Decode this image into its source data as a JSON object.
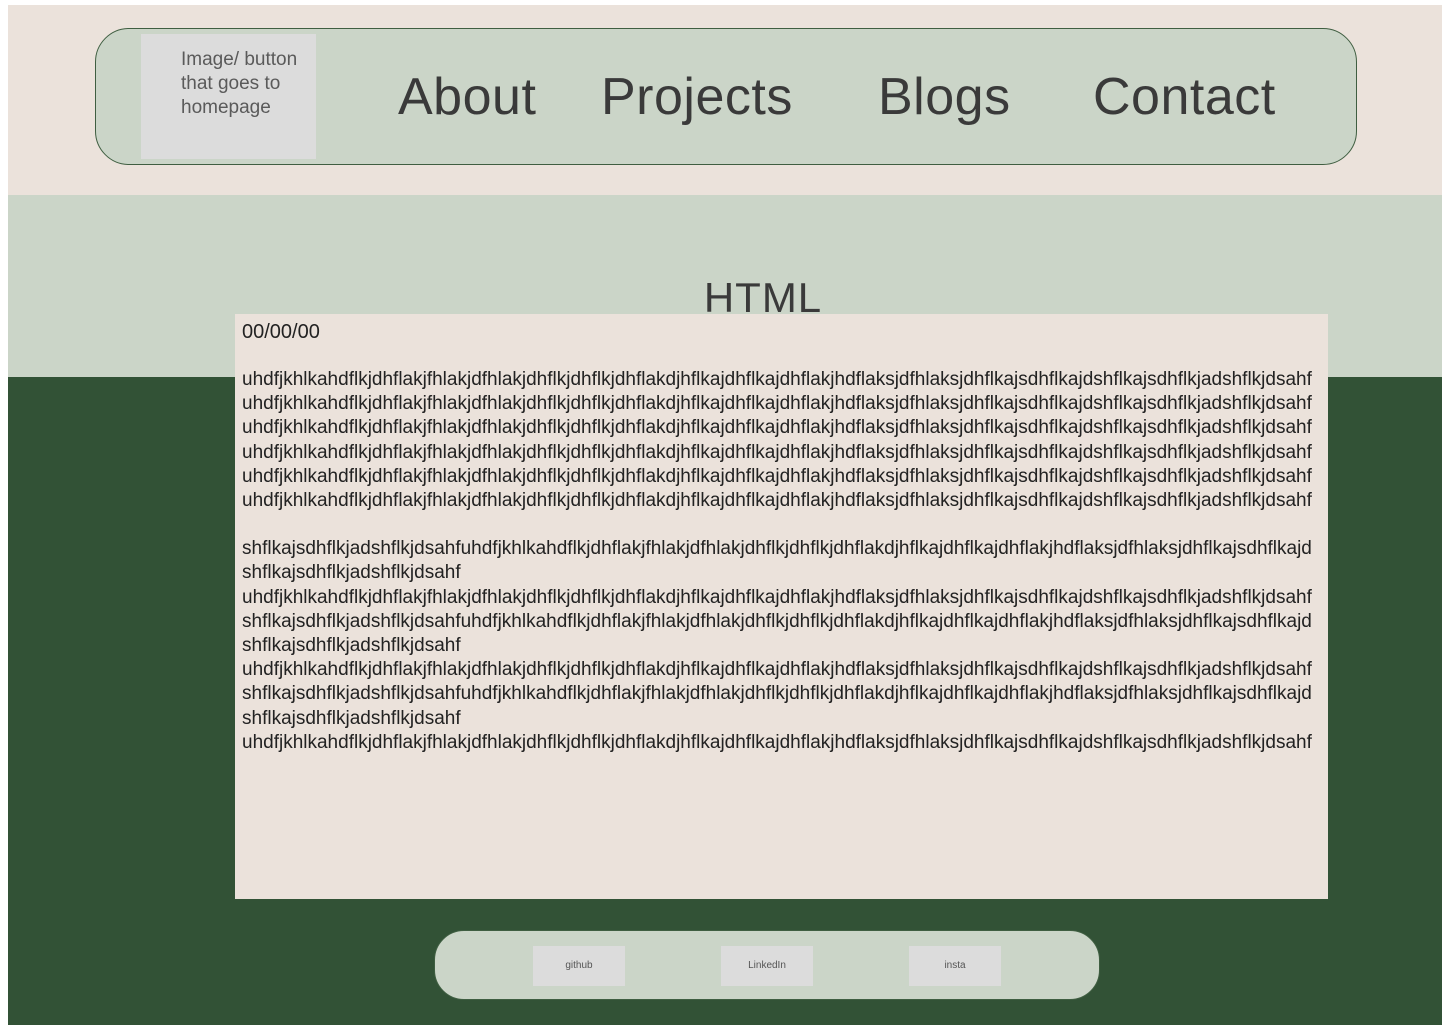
{
  "nav": {
    "home_button_label": "Image/ button that goes to homepage",
    "links": [
      "About",
      "Projects",
      "Blogs",
      "Contact"
    ]
  },
  "page": {
    "title": "HTML"
  },
  "article": {
    "date": "00/00/00",
    "block1": [
      "uhdfjkhlkahdflkjdhflakjfhlakjdfhlakjdhflkjdhflkjdhflakdjhflkajdhflkajdhflakjhdflaksjdfhlaksjdhflkajsdhflkajdshflkajsdhflkjadshflkjdsahf",
      "uhdfjkhlkahdflkjdhflakjfhlakjdfhlakjdhflkjdhflkjdhflakdjhflkajdhflkajdhflakjhdflaksjdfhlaksjdhflkajsdhflkajdshflkajsdhflkjadshflkjdsahf",
      "uhdfjkhlkahdflkjdhflakjfhlakjdfhlakjdhflkjdhflkjdhflakdjhflkajdhflkajdhflakjhdflaksjdfhlaksjdhflkajsdhflkajdshflkajsdhflkjadshflkjdsahf",
      "uhdfjkhlkahdflkjdhflakjfhlakjdfhlakjdhflkjdhflkjdhflakdjhflkajdhflkajdhflakjhdflaksjdfhlaksjdhflkajsdhflkajdshflkajsdhflkjadshflkjdsahfuhdfjkhlkahdflkjdhflakjfhlakjdfhlakjdhflkjdhflkjdhflakdjhflkajdhflkajdhflakjhdflaksjdfhlaksjdhflkajsdhflkajdshflkajsdhflkjadshflkjdsahf",
      "uhdfjkhlkahdflkjdhflakjfhlakjdfhlakjdhflkjdhflkjdhflakdjhflkajdhflkajdhflakjhdflaksjdfhlaksjdhflkajsdhflkajdshflkajsdhflkjadshflkjdsahf"
    ],
    "block2": [
      "shflkajsdhflkjadshflkjdsahfuhdfjkhlkahdflkjdhflakjfhlakjdfhlakjdhflkjdhflkjdhflakdjhflkajdhflkajdhflakjhdflaksjdfhlaksjdhflkajsdhflkajdshflkajsdhflkjadshflkjdsahf",
      "uhdfjkhlkahdflkjdhflakjfhlakjdfhlakjdhflkjdhflkjdhflakdjhflkajdhflkajdhflakjhdflaksjdfhlaksjdhflkajsdhflkajdshflkajsdhflkjadshflkjdsahfshflkajsdhflkjadshflkjdsahfuhdfjkhlkahdflkjdhflakjfhlakjdfhlakjdhflkjdhflkjdhflakdjhflkajdhflkajdhflakjhdflaksjdfhlaksjdhflkajsdhflkajdshflkajsdhflkjadshflkjdsahf",
      "uhdfjkhlkahdflkjdhflakjfhlakjdfhlakjdhflkjdhflkjdhflakdjhflkajdhflkajdhflakjhdflaksjdfhlaksjdhflkajsdhflkajdshflkajsdhflkjadshflkjdsahfshflkajsdhflkjadshflkjdsahfuhdfjkhlkahdflkjdhflakjfhlakjdfhlakjdhflkjdhflkjdhflakdjhflkajdhflkajdhflakjhdflaksjdfhlaksjdhflkajsdhflkajdshflkajsdhflkjadshflkjdsahf",
      "uhdfjkhlkahdflkjdhflakjfhlakjdfhlakjdhflkjdhflkjdhflakdjhflkajdhflkajdhflakjhdflaksjdfhlaksjdhflkajsdhflkajdshflkajsdhflkjadshflkjdsahf"
    ]
  },
  "footer": {
    "links": [
      "github",
      "LinkedIn",
      "insta"
    ]
  },
  "colors": {
    "beige": "#ebe2db",
    "sage": "#cbd5c8",
    "forest": "#325236",
    "button_gray": "#dcdcdc"
  }
}
